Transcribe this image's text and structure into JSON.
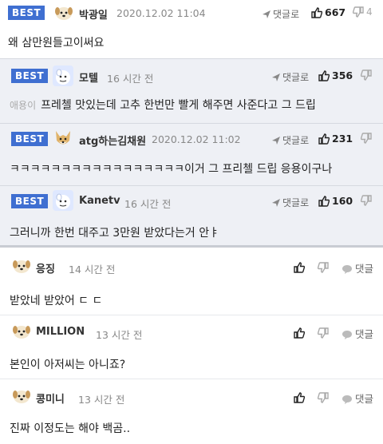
{
  "best_label": "BEST",
  "best": [
    {
      "nick": "박광일",
      "time": "2020.12.02 11:04",
      "reply_label": "댓글로",
      "up": "667",
      "down": "4",
      "prefix": "",
      "text": "왜 삼만원들고이써요"
    },
    {
      "nick": "모텔",
      "time": "16 시간 전",
      "reply_label": "댓글로",
      "up": "356",
      "down": "",
      "prefix": "애용이",
      "text": "프레첼 맛있는데 고추 한번만 빨게 해주면 사준다고 그 드립"
    },
    {
      "nick": "atg하는김채원",
      "time": "2020.12.02 11:02",
      "reply_label": "댓글로",
      "up": "231",
      "down": "",
      "prefix": "",
      "text": "ㅋㅋㅋㅋㅋㅋㅋㅋㅋㅋㅋㅋㅋㅋㅋㅋㅋ이거 그 프리첼 드립 응용이구나"
    },
    {
      "nick": "Kanetv",
      "time": "16 시간 전",
      "reply_label": "댓글로",
      "up": "160",
      "down": "",
      "prefix": "",
      "text": "그러니까 한번 대주고 3만원 받았다는거 안ㅑ"
    }
  ],
  "comments": [
    {
      "nick": "응징",
      "time": "14 시간 전",
      "reply_label": "댓글",
      "text": "받았네 받았어 ㄷ ㄷ"
    },
    {
      "nick": "MILLION",
      "time": "13 시간 전",
      "reply_label": "댓글",
      "text": "본인이 아저씨는 아니죠?"
    },
    {
      "nick": "콩미니",
      "time": "13 시간 전",
      "reply_label": "댓글",
      "text": "진짜 이정도는 해야 백곰.."
    }
  ]
}
